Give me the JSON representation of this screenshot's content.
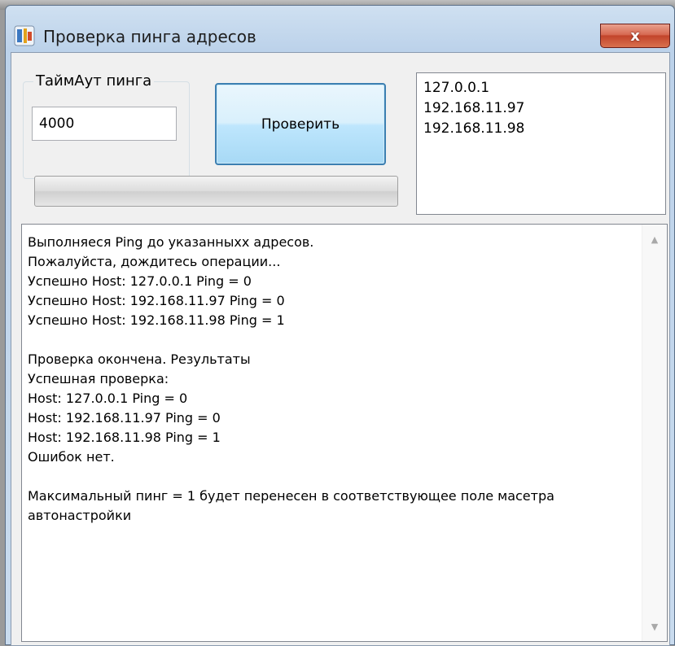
{
  "window": {
    "title": "Проверка пинга адресов",
    "close_glyph": "x"
  },
  "timeout_group": {
    "legend": "ТаймАут пинга",
    "value": "4000"
  },
  "check_button": {
    "label": "Проверить"
  },
  "progress": {
    "value": 0
  },
  "addresses": [
    "127.0.0.1",
    "192.168.11.97",
    "192.168.11.98"
  ],
  "log": [
    "Выполняеся Ping до указанныхх адресов.",
    "Пожалуйста, дождитесь операции...",
    "Успешно Host: 127.0.0.1 Ping = 0",
    "Успешно Host: 192.168.11.97 Ping = 0",
    "Успешно Host: 192.168.11.98 Ping = 1",
    "",
    "Проверка окончена. Результаты",
    "Успешная проверка:",
    "Host: 127.0.0.1 Ping = 0",
    "Host: 192.168.11.97 Ping = 0",
    "Host: 192.168.11.98 Ping = 1",
    "Ошибок нет.",
    "",
    "Максимальный пинг = 1 будет перенесен в соответствующее поле масетра автонастройки"
  ]
}
